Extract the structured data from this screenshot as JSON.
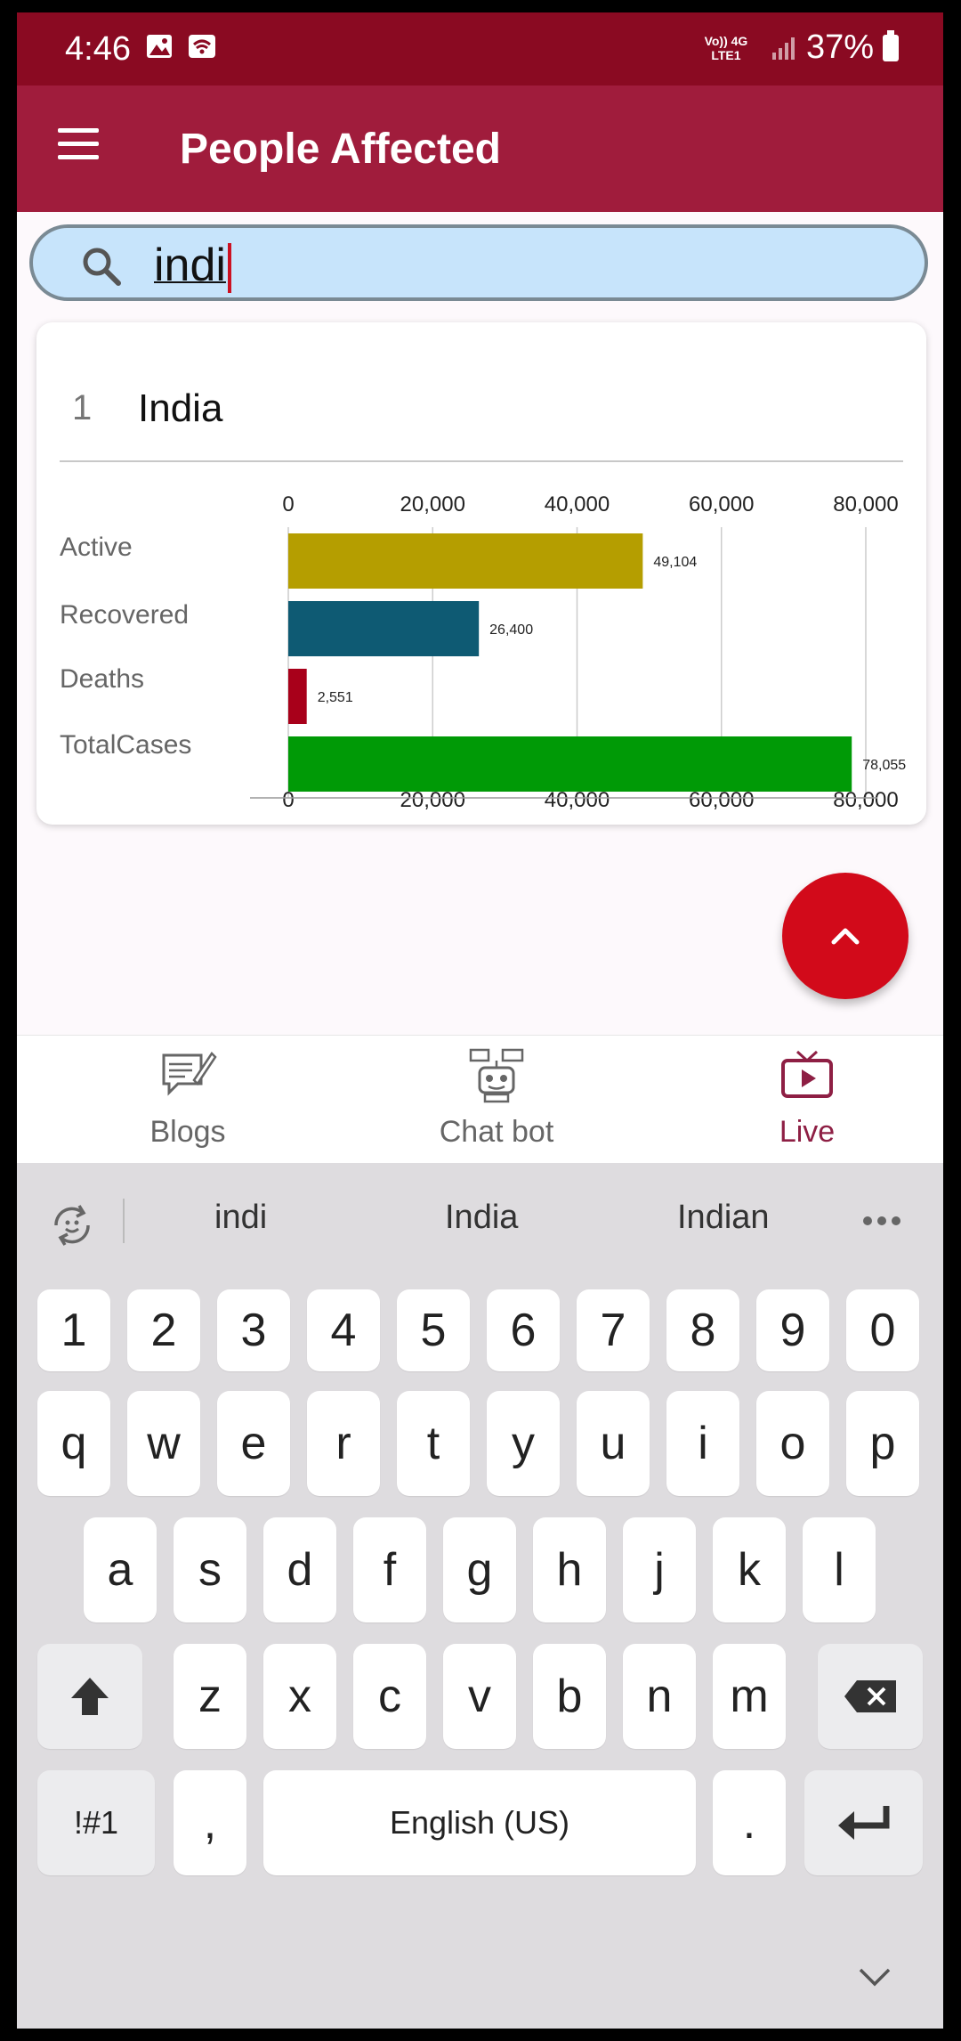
{
  "status_bar": {
    "time": "4:46",
    "network": "Vo)) 4G LTE1",
    "battery": "37%"
  },
  "app_bar": {
    "title": "People Affected"
  },
  "search": {
    "value": "indi"
  },
  "result": {
    "rank": "1",
    "country": "India",
    "chart_data": {
      "type": "bar",
      "orientation": "horizontal",
      "categories": [
        "Active",
        "Recovered",
        "Deaths",
        "TotalCases"
      ],
      "values": [
        49104,
        26400,
        2551,
        78055
      ],
      "value_labels": [
        "49,104",
        "26,400",
        "2,551",
        "78,055"
      ],
      "colors": [
        "#b59e00",
        "#0e5a73",
        "#a8001a",
        "#009a06"
      ],
      "xlim": [
        0,
        80000
      ],
      "ticks": [
        0,
        20000,
        40000,
        60000,
        80000
      ],
      "tick_labels": [
        "0",
        "20,000",
        "40,000",
        "60,000",
        "80,000"
      ],
      "grid": true
    }
  },
  "fab": {
    "icon": "chevron-up-icon"
  },
  "bottom_nav": {
    "items": [
      {
        "label": "Blogs",
        "icon": "blog-icon",
        "active": false
      },
      {
        "label": "Chat bot",
        "icon": "robot-icon",
        "active": false
      },
      {
        "label": "Live",
        "icon": "tv-icon",
        "active": true
      }
    ]
  },
  "keyboard": {
    "suggestions": [
      "indi",
      "India",
      "Indian"
    ],
    "row_numbers": [
      "1",
      "2",
      "3",
      "4",
      "5",
      "6",
      "7",
      "8",
      "9",
      "0"
    ],
    "row1": [
      "q",
      "w",
      "e",
      "r",
      "t",
      "y",
      "u",
      "i",
      "o",
      "p"
    ],
    "row2": [
      "a",
      "s",
      "d",
      "f",
      "g",
      "h",
      "j",
      "k",
      "l"
    ],
    "row3": [
      "z",
      "x",
      "c",
      "v",
      "b",
      "n",
      "m"
    ],
    "symbols_key": "!#1",
    "comma_key": ",",
    "space_key": "English (US)",
    "period_key": "."
  }
}
